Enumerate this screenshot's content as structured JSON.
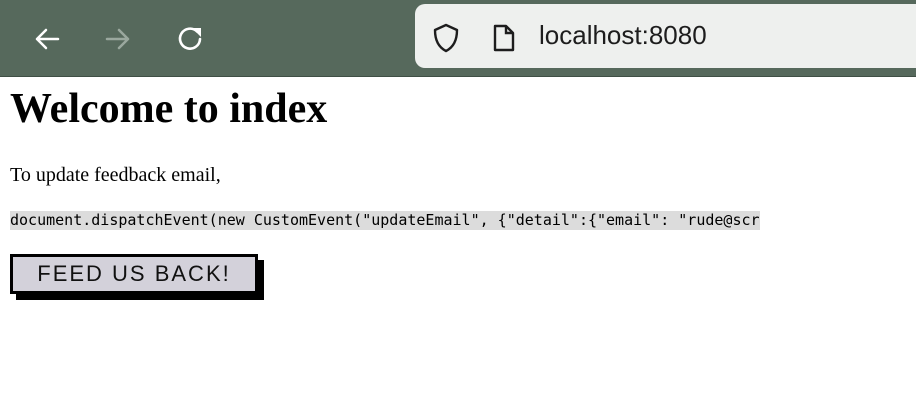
{
  "browser": {
    "url": "localhost:8080",
    "icons": [
      "back-arrow-icon",
      "forward-arrow-icon",
      "reload-icon",
      "shield-icon",
      "page-icon"
    ]
  },
  "page": {
    "title": "Welcome to index",
    "instruction": "To update feedback email,",
    "code": "document.dispatchEvent(new CustomEvent(\"updateEmail\", {\"detail\":{\"email\": \"rude@scr",
    "button_label": "FEED US BACK!"
  }
}
